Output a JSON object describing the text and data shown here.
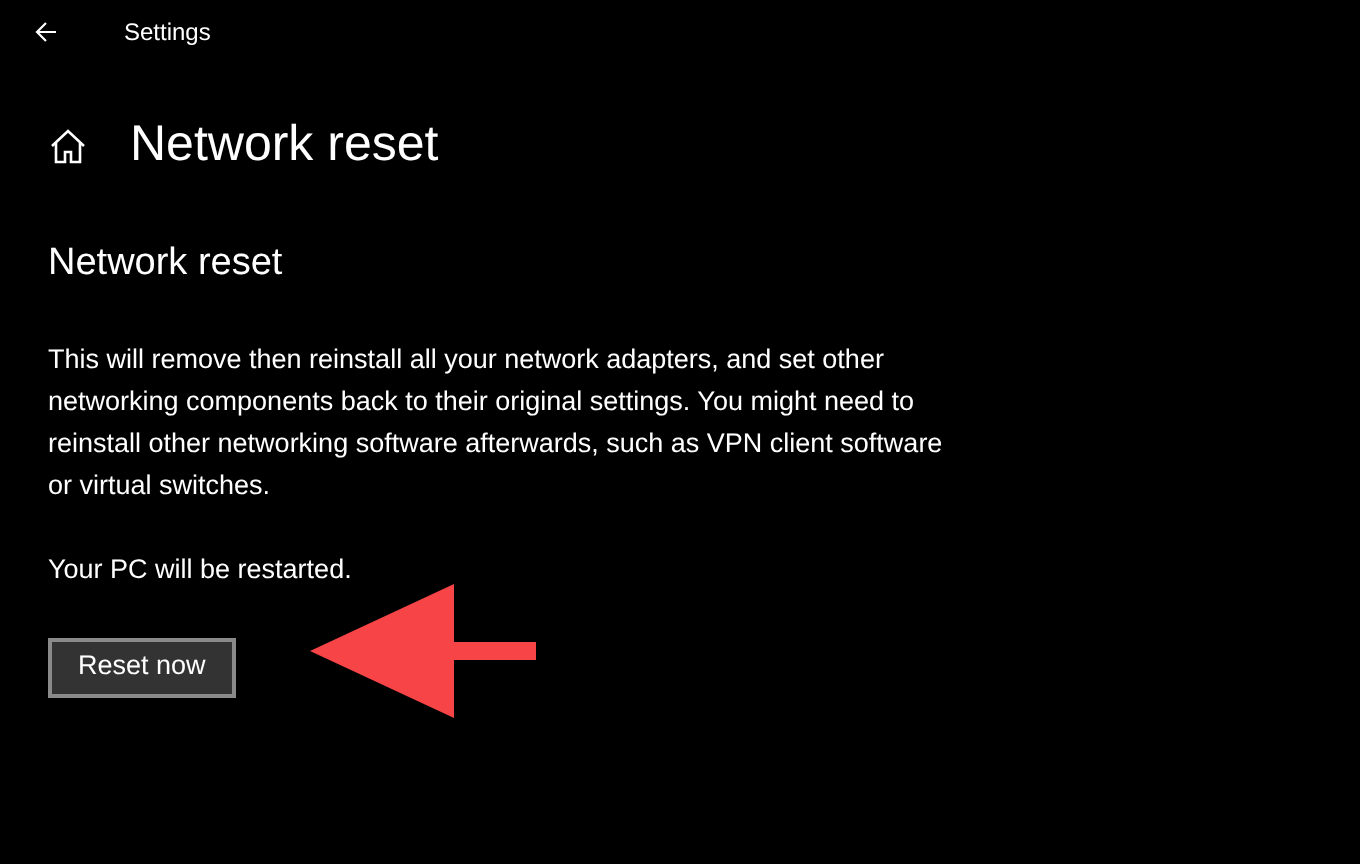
{
  "window": {
    "title": "Settings"
  },
  "page": {
    "title": "Network reset"
  },
  "section": {
    "heading": "Network reset",
    "description": "This will remove then reinstall all your network adapters, and set other networking components back to their original settings. You might need to reinstall other networking software afterwards, such as VPN client software or virtual switches.",
    "note": "Your PC will be restarted."
  },
  "buttons": [
    {
      "label": "Reset now"
    }
  ]
}
